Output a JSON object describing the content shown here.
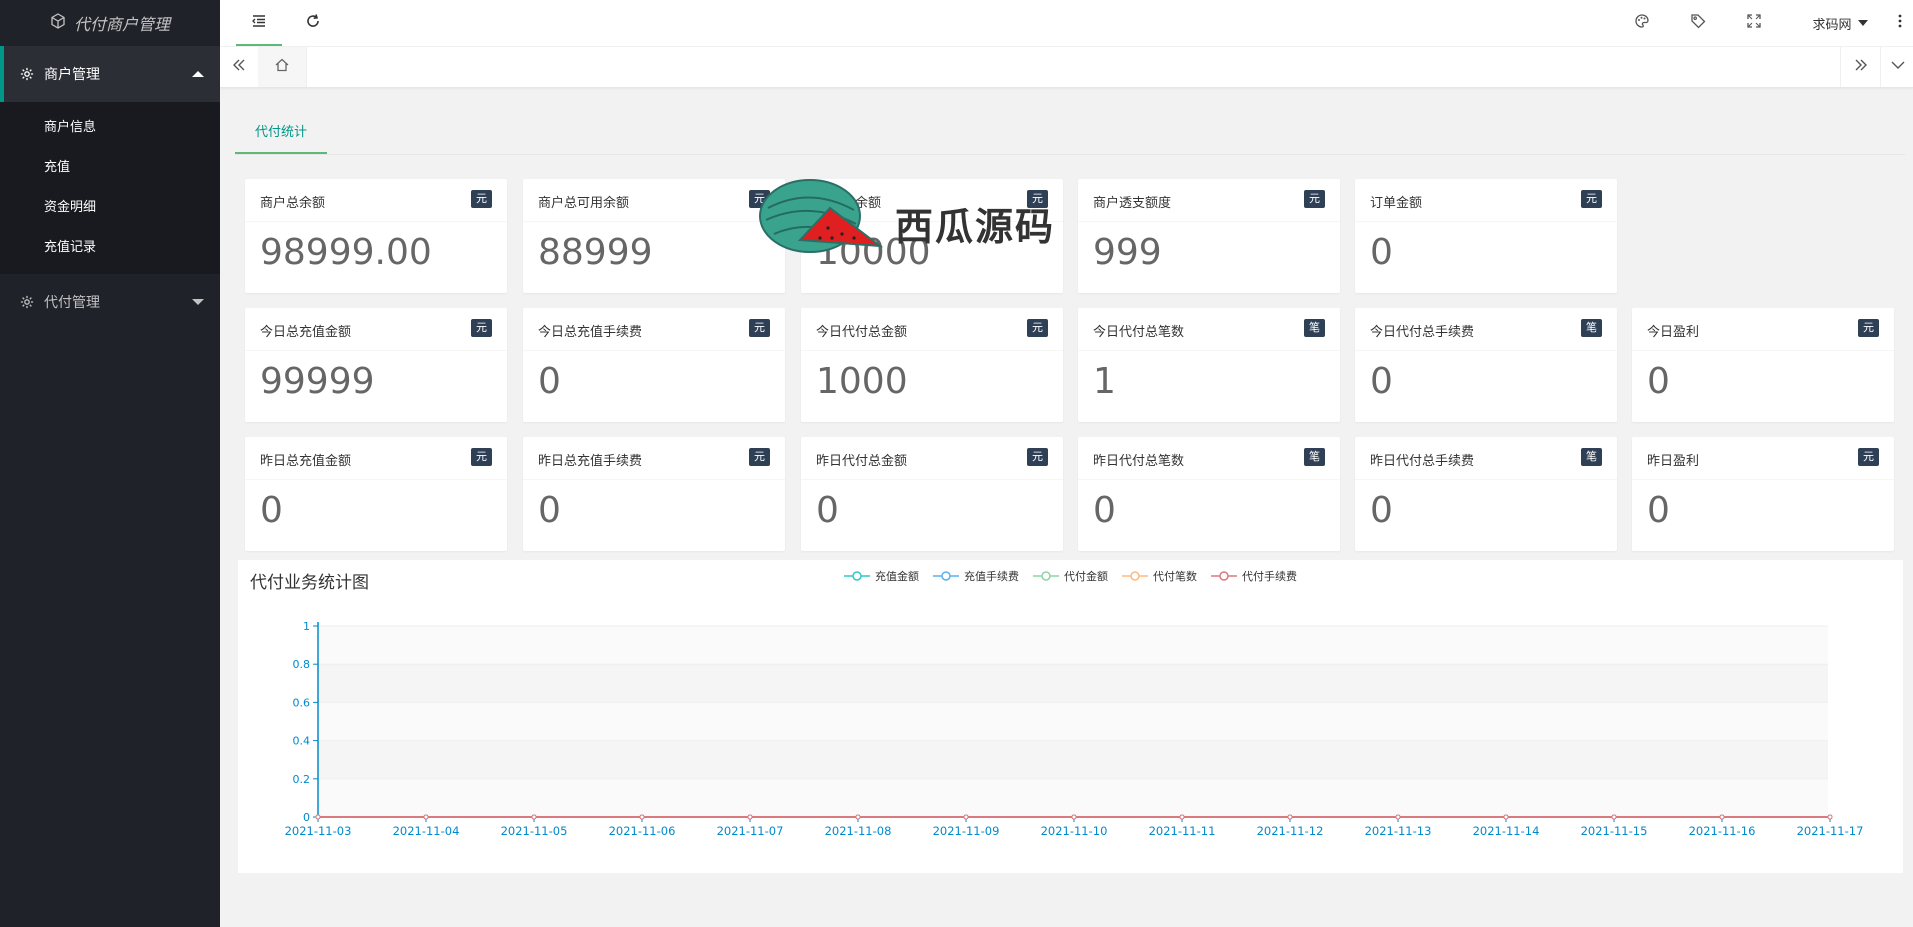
{
  "app": {
    "title": "代付商户管理"
  },
  "sidebar": {
    "groups": [
      {
        "label": "商户管理",
        "items": [
          "商户信息",
          "充值",
          "资金明细",
          "充值记录"
        ]
      },
      {
        "label": "代付管理"
      }
    ]
  },
  "header": {
    "user": "求码网"
  },
  "content": {
    "tab": "代付统计"
  },
  "cards": [
    {
      "title": "商户总余额",
      "badge": "元",
      "value": "98999.00"
    },
    {
      "title": "商户总可用余额",
      "badge": "元",
      "value": "88999"
    },
    {
      "title": "不可用余额",
      "badge": "元",
      "value": "10000"
    },
    {
      "title": "商户透支额度",
      "badge": "元",
      "value": "999"
    },
    {
      "title": "订单金额",
      "badge": "元",
      "value": "0"
    },
    {
      "title": "今日总充值金额",
      "badge": "元",
      "value": "99999"
    },
    {
      "title": "今日总充值手续费",
      "badge": "元",
      "value": "0"
    },
    {
      "title": "今日代付总金额",
      "badge": "元",
      "value": "1000"
    },
    {
      "title": "今日代付总笔数",
      "badge": "笔",
      "value": "1"
    },
    {
      "title": "今日代付总手续费",
      "badge": "笔",
      "value": "0"
    },
    {
      "title": "今日盈利",
      "badge": "元",
      "value": "0"
    },
    {
      "title": "昨日总充值金额",
      "badge": "元",
      "value": "0"
    },
    {
      "title": "昨日总充值手续费",
      "badge": "元",
      "value": "0"
    },
    {
      "title": "昨日代付总金额",
      "badge": "元",
      "value": "0"
    },
    {
      "title": "昨日代付总笔数",
      "badge": "笔",
      "value": "0"
    },
    {
      "title": "昨日代付总手续费",
      "badge": "笔",
      "value": "0"
    },
    {
      "title": "昨日盈利",
      "badge": "元",
      "value": "0"
    }
  ],
  "watermark": {
    "text": "西瓜源码"
  },
  "colors": {
    "accent": "#009688",
    "sidebar": "#20222a",
    "badge": "#2f4056"
  },
  "chart_data": {
    "type": "line",
    "title": "代付业务统计图",
    "x": [
      "2021-11-03",
      "2021-11-04",
      "2021-11-05",
      "2021-11-06",
      "2021-11-07",
      "2021-11-08",
      "2021-11-09",
      "2021-11-10",
      "2021-11-11",
      "2021-11-12",
      "2021-11-13",
      "2021-11-14",
      "2021-11-15",
      "2021-11-16",
      "2021-11-17"
    ],
    "ylim": [
      0,
      1
    ],
    "yticks": [
      "0",
      "0.2",
      "0.4",
      "0.6",
      "0.8",
      "1"
    ],
    "grid": true,
    "legend_position": "top-center",
    "series": [
      {
        "name": "充值金额",
        "color": "#2ec7c9",
        "values": [
          0,
          0,
          0,
          0,
          0,
          0,
          0,
          0,
          0,
          0,
          0,
          0,
          0,
          0,
          0
        ]
      },
      {
        "name": "充值手续费",
        "color": "#5ab1ef",
        "values": [
          0,
          0,
          0,
          0,
          0,
          0,
          0,
          0,
          0,
          0,
          0,
          0,
          0,
          0,
          0
        ]
      },
      {
        "name": "代付金额",
        "color": "#8fd3a4",
        "values": [
          0,
          0,
          0,
          0,
          0,
          0,
          0,
          0,
          0,
          0,
          0,
          0,
          0,
          0,
          0
        ]
      },
      {
        "name": "代付笔数",
        "color": "#ffb980",
        "values": [
          0,
          0,
          0,
          0,
          0,
          0,
          0,
          0,
          0,
          0,
          0,
          0,
          0,
          0,
          0
        ]
      },
      {
        "name": "代付手续费",
        "color": "#d87a80",
        "values": [
          0,
          0,
          0,
          0,
          0,
          0,
          0,
          0,
          0,
          0,
          0,
          0,
          0,
          0,
          0
        ]
      }
    ]
  }
}
